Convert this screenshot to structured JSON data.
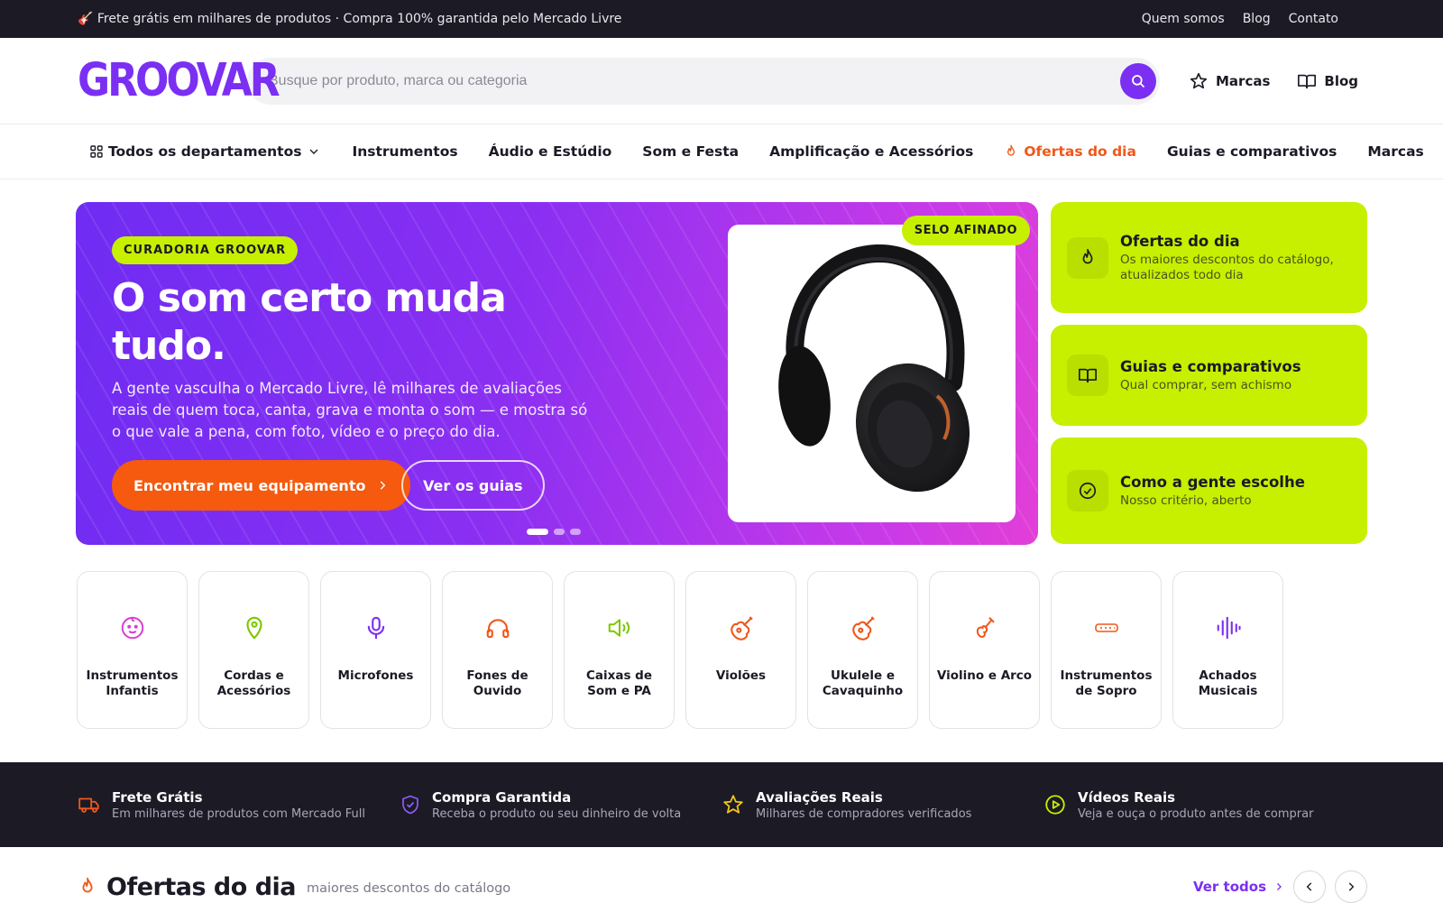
{
  "topbar": {
    "promo": "🎸 Frete grátis em milhares de produtos · Compra 100% garantida pelo Mercado Livre",
    "links": [
      "Quem somos",
      "Blog",
      "Contato"
    ]
  },
  "header": {
    "logo": "GROOVAR",
    "search_placeholder": "Busque por produto, marca ou categoria",
    "links": [
      {
        "label": "Marcas",
        "icon": "star-icon"
      },
      {
        "label": "Blog",
        "icon": "book-icon"
      }
    ]
  },
  "nav": {
    "departments": "Todos os departamentos",
    "items": [
      "Instrumentos",
      "Áudio e Estúdio",
      "Som e Festa",
      "Amplificação e Acessórios"
    ],
    "hot": "Ofertas do dia",
    "items2": [
      "Guias e comparativos",
      "Marcas"
    ]
  },
  "hero": {
    "pill": "CURADORIA GROOVAR",
    "title": "O som certo muda tudo.",
    "description": "A gente vasculha o Mercado Livre, lê milhares de avaliações reais de quem toca, canta, grava e monta o som — e mostra só o que vale a pena, com foto, vídeo e o preço do dia.",
    "primary_button": "Encontrar meu equipamento",
    "secondary_button": "Ver os guias",
    "seal": "SELO AFINADO",
    "slide_count": 3,
    "active_slide": 1
  },
  "side_cards": [
    {
      "title": "Ofertas do dia",
      "subtitle": "Os maiores descontos do catálogo, atualizados todo dia",
      "icon": "flame-icon"
    },
    {
      "title": "Guias e comparativos",
      "subtitle": "Qual comprar, sem achismo",
      "icon": "book-icon"
    },
    {
      "title": "Como a gente escolhe",
      "subtitle": "Nosso critério, aberto",
      "icon": "check-circle-icon"
    }
  ],
  "categories": [
    {
      "label": "Instrumentos Infantis",
      "icon": "baby-icon"
    },
    {
      "label": "Cordas e Acessórios",
      "icon": "guitar-pick-icon"
    },
    {
      "label": "Microfones",
      "icon": "microphone-icon"
    },
    {
      "label": "Fones de Ouvido",
      "icon": "headphones-icon"
    },
    {
      "label": "Caixas de Som e PA",
      "icon": "speaker-icon"
    },
    {
      "label": "Violões",
      "icon": "guitar-icon"
    },
    {
      "label": "Ukulele e Cavaquinho",
      "icon": "ukulele-icon"
    },
    {
      "label": "Violino e Arco",
      "icon": "violin-icon"
    },
    {
      "label": "Instrumentos de Sopro",
      "icon": "harmonica-icon"
    },
    {
      "label": "Achados Musicais",
      "icon": "waveform-icon"
    }
  ],
  "trust": [
    {
      "title": "Frete Grátis",
      "subtitle": "Em milhares de produtos com Mercado Full",
      "icon": "truck-icon"
    },
    {
      "title": "Compra Garantida",
      "subtitle": "Receba o produto ou seu dinheiro de volta",
      "icon": "shield-icon"
    },
    {
      "title": "Avaliações Reais",
      "subtitle": "Milhares de compradores verificados",
      "icon": "star-icon"
    },
    {
      "title": "Vídeos Reais",
      "subtitle": "Veja e ouça o produto antes de comprar",
      "icon": "play-icon"
    }
  ],
  "offers": {
    "title": "Ofertas do dia",
    "subtitle": "maiores descontos do catálogo",
    "see_all": "Ver todos"
  },
  "colors": {
    "purple": "#7b2ff2",
    "lime": "#c6f000",
    "orange": "#f55a0f",
    "dark": "#1b1a25"
  }
}
